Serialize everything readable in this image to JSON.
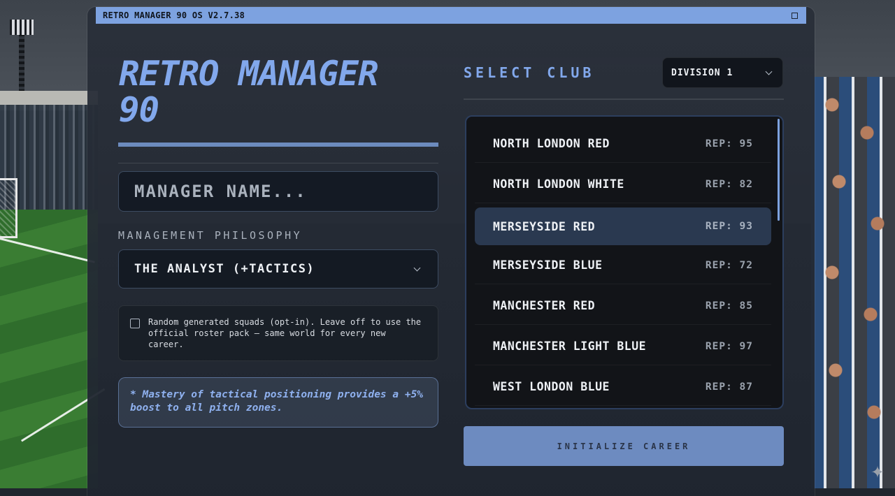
{
  "window": {
    "title": "RETRO MANAGER 90 OS V2.7.38"
  },
  "game": {
    "title": "RETRO MANAGER 90"
  },
  "manager": {
    "name_placeholder": "MANAGER NAME..."
  },
  "philosophy": {
    "label": "MANAGEMENT PHILOSOPHY",
    "selected": "THE ANALYST (+TACTICS)"
  },
  "random_squads": {
    "checked": false,
    "text": "Random generated squads (opt-in). Leave off to use the official roster pack — same world for every new career."
  },
  "tip": {
    "text": "* Mastery of tactical positioning provides a +5% boost to all pitch zones."
  },
  "club_select": {
    "heading": "SELECT CLUB",
    "division": "DIVISION 1",
    "selected_index": 2,
    "clubs": [
      {
        "name": "NORTH LONDON RED",
        "rep": "REP: 95"
      },
      {
        "name": "NORTH LONDON WHITE",
        "rep": "REP: 82"
      },
      {
        "name": "MERSEYSIDE RED",
        "rep": "REP: 93"
      },
      {
        "name": "MERSEYSIDE BLUE",
        "rep": "REP: 72"
      },
      {
        "name": "MANCHESTER RED",
        "rep": "REP: 85"
      },
      {
        "name": "MANCHESTER LIGHT BLUE",
        "rep": "REP: 97"
      },
      {
        "name": "WEST LONDON BLUE",
        "rep": "REP: 87"
      }
    ]
  },
  "actions": {
    "initialize": "INITIALIZE CAREER"
  },
  "colors": {
    "accent": "#7da2e0",
    "selected_row": "#2a3950",
    "button": "#6d8bc0"
  },
  "icons": {
    "dropdown": "chevron-down-icon",
    "corner": "sparkle-icon"
  }
}
